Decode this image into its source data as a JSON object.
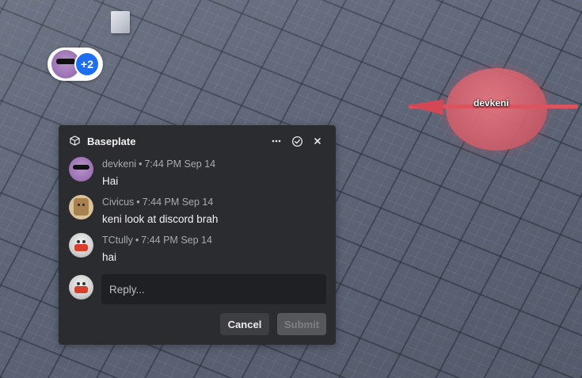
{
  "scene": {
    "collaborators": {
      "count_label": "+2"
    },
    "player": {
      "name": "devkeni"
    }
  },
  "panel": {
    "title": "Baseplate",
    "comments": [
      {
        "author": "devkeni",
        "time": "7:44 PM Sep 14",
        "text": "Hai"
      },
      {
        "author": "Civicus",
        "time": "7:44 PM Sep 14",
        "text": "keni look at discord brah"
      },
      {
        "author": "TCtully",
        "time": "7:44 PM Sep 14",
        "text": "hai"
      }
    ],
    "reply": {
      "placeholder": "Reply..."
    },
    "cancel_label": "Cancel",
    "submit_label": "Submit"
  },
  "colors": {
    "panel_bg": "#2b2c2f",
    "accent_blue": "#1d6ef0",
    "player_marker": "#d9545f"
  }
}
